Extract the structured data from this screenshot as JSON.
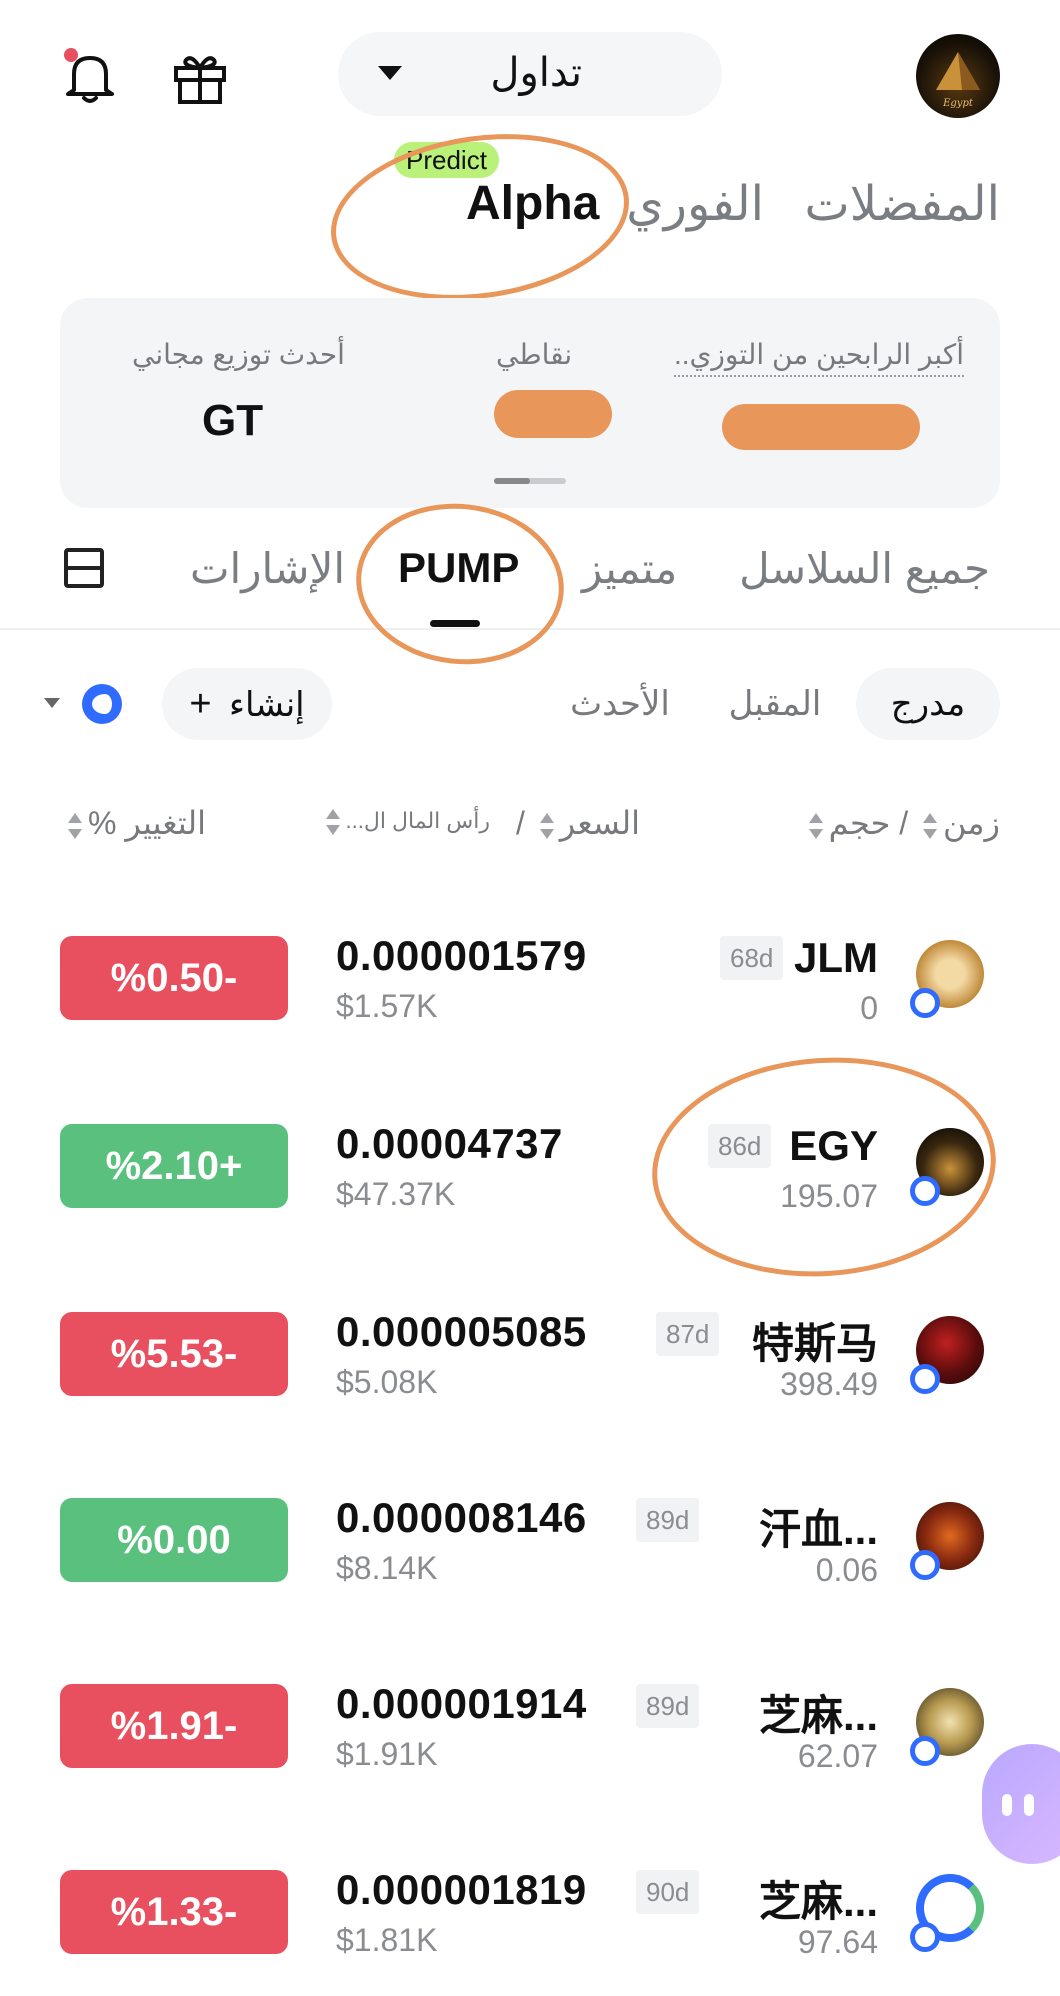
{
  "header": {
    "trade_label": "تداول",
    "predict_badge": "Predict"
  },
  "main_tabs": [
    {
      "label": "المفضلات"
    },
    {
      "label": "الفوري"
    },
    {
      "label": "Alpha"
    }
  ],
  "info_card": {
    "top_gainers_label": "أكبر الرابحين من التوزي..",
    "points_label": "نقاطي",
    "latest_airdrop_label": "أحدث توزيع مجاني",
    "latest_airdrop_value": "GT"
  },
  "sub_tabs": [
    {
      "label": "جميع السلاسل"
    },
    {
      "label": "متميز"
    },
    {
      "label": "PUMP"
    },
    {
      "label": "الإشارات"
    }
  ],
  "filters": {
    "listed": "مدرج",
    "upcoming": "المقبل",
    "latest": "الأحدث",
    "create": "إنشاء"
  },
  "columns": {
    "time": "زمن",
    "volume": "حجم",
    "price": "السعر",
    "market_cap": "رأس المال ال...",
    "change": "التغيير %"
  },
  "tokens": [
    {
      "symbol": "JLM",
      "age": "68d",
      "volume": "0",
      "price": "0.000001579",
      "mcap": "$1.57K",
      "change": "%0.50-",
      "direction": "down"
    },
    {
      "symbol": "EGY",
      "age": "86d",
      "volume": "195.07",
      "price": "0.00004737",
      "mcap": "$47.37K",
      "change": "%2.10+",
      "direction": "up"
    },
    {
      "symbol": "特斯马",
      "age": "87d",
      "volume": "398.49",
      "price": "0.000005085",
      "mcap": "$5.08K",
      "change": "%5.53-",
      "direction": "down"
    },
    {
      "symbol": "汗血...",
      "age": "89d",
      "volume": "0.06",
      "price": "0.000008146",
      "mcap": "$8.14K",
      "change": "%0.00",
      "direction": "flat"
    },
    {
      "symbol": "芝麻...",
      "age": "89d",
      "volume": "62.07",
      "price": "0.000001914",
      "mcap": "$1.91K",
      "change": "%1.91-",
      "direction": "down"
    },
    {
      "symbol": "芝麻...",
      "age": "90d",
      "volume": "97.64",
      "price": "0.000001819",
      "mcap": "$1.81K",
      "change": "%1.33-",
      "direction": "down"
    }
  ],
  "colors": {
    "negative": "#e8505f",
    "positive": "#5ac07e",
    "annotation": "#e8965a",
    "predict_badge": "#b9f17a",
    "chain_blue": "#2f6bff"
  }
}
